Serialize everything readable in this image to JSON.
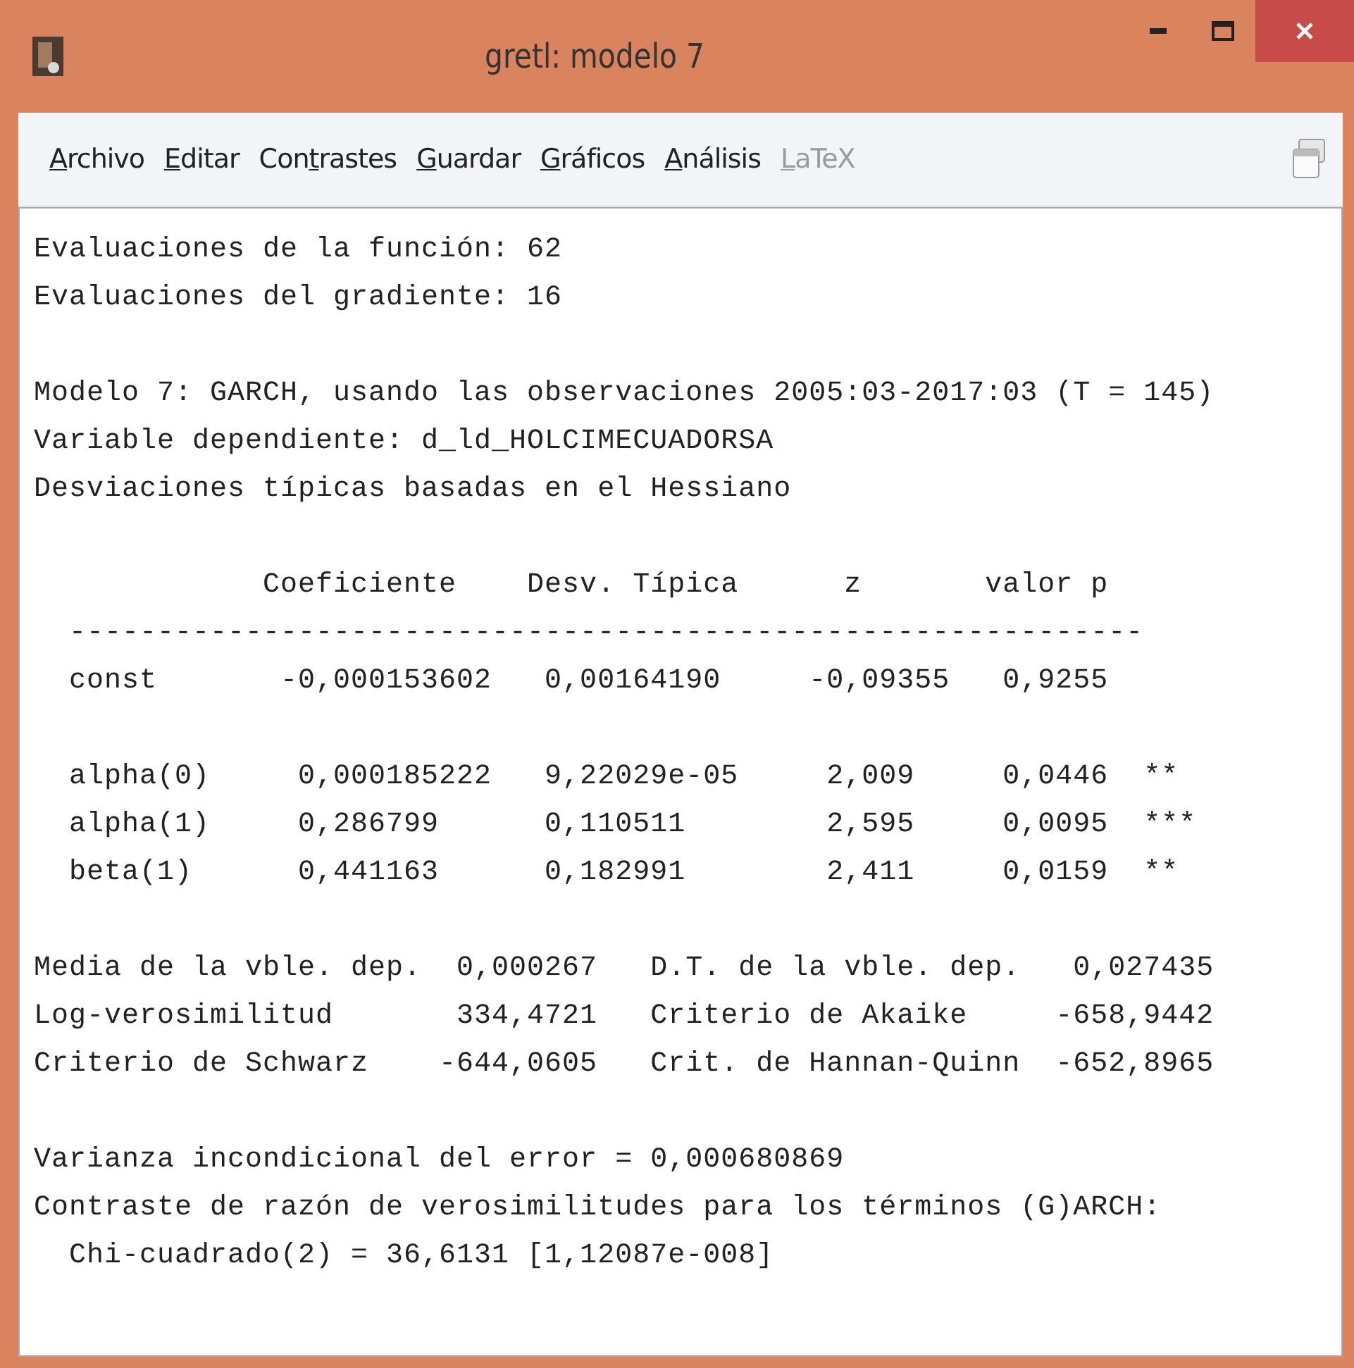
{
  "window": {
    "title": "gretl: modelo 7"
  },
  "menu": [
    {
      "key": "A",
      "post": "rchivo",
      "disabled": false
    },
    {
      "key": "E",
      "post": "ditar",
      "disabled": false
    },
    {
      "pre": "Con",
      "key": "t",
      "post": "rastes",
      "disabled": false
    },
    {
      "key": "G",
      "post": "uardar",
      "disabled": false
    },
    {
      "key": "G",
      "post": "ráficos",
      "disabled": false
    },
    {
      "key": "A",
      "post": "nálisis",
      "disabled": false
    },
    {
      "key": "L",
      "post": "aTeX",
      "disabled": true
    }
  ],
  "output": {
    "blocks": [
      {
        "lines": [
          "Evaluaciones de la función: 62",
          "Evaluaciones del gradiente: 16"
        ]
      },
      {
        "lines": [
          "Modelo 7: GARCH, usando las observaciones 2005:03-2017:03 (T = 145)",
          "Variable dependiente: d_ld_HOLCIMECUADORSA",
          "Desviaciones típicas basadas en el Hessiano"
        ]
      },
      {
        "lines": [
          "             Coeficiente    Desv. Típica      z       valor p",
          "  -------------------------------------------------------------",
          "  const       -0,000153602   0,00164190     -0,09355   0,9255"
        ]
      },
      {
        "lines": [
          "  alpha(0)     0,000185222   9,22029e-05     2,009     0,0446  **",
          "  alpha(1)     0,286799      0,110511        2,595     0,0095  ***",
          "  beta(1)      0,441163      0,182991        2,411     0,0159  **"
        ]
      },
      {
        "lines": [
          "Media de la vble. dep.  0,000267   D.T. de la vble. dep.   0,027435",
          "Log-verosimilitud       334,4721   Criterio de Akaike     -658,9442",
          "Criterio de Schwarz    -644,0605   Crit. de Hannan-Quinn  -652,8965"
        ]
      },
      {
        "lines": [
          "Varianza incondicional del error = 0,000680869",
          "Contraste de razón de verosimilitudes para los términos (G)ARCH:",
          "  Chi-cuadrado(2) = 36,6131 [1,12087e-008]"
        ]
      }
    ]
  }
}
